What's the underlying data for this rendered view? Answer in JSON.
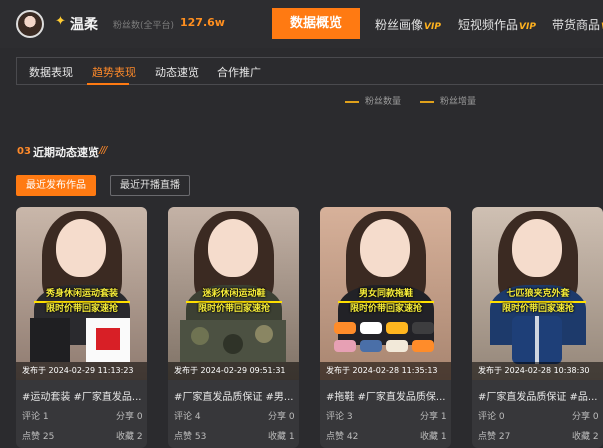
{
  "header": {
    "username": "温柔",
    "fans_label": "粉丝数(全平台)",
    "fans_value": "127.6w",
    "nav": [
      {
        "label": "数据概览",
        "vip": false
      },
      {
        "label": "粉丝画像",
        "vip": true
      },
      {
        "label": "短视频作品",
        "vip": true
      },
      {
        "label": "带货商品",
        "vip": true
      }
    ],
    "vip_text": "VIP"
  },
  "subtabs": [
    "数据表现",
    "趋势表现",
    "动态速览",
    "合作推广"
  ],
  "active_subtab": "趋势表现",
  "legend": [
    "粉丝数量",
    "粉丝增量"
  ],
  "section": {
    "number": "03",
    "title": "近期动态速览",
    "deco": "///"
  },
  "buttons": {
    "latest_works": "最近发布作品",
    "latest_live": "最近开播直播"
  },
  "cards": [
    {
      "caption_top": "秀身休闲运动套装",
      "caption_bottom": "限时价带回家速抢",
      "time": "发布于 2024-02-29 11:13:23",
      "title": "#运动套装 #厂家直发品...",
      "comments_label": "评论",
      "comments": "1",
      "shares_label": "分享",
      "shares": "0",
      "likes_label": "点赞",
      "likes": "25",
      "favorites_label": "收藏",
      "favorites": "2"
    },
    {
      "caption_top": "迷彩休闲运动鞋",
      "caption_bottom": "限时价带回家速抢",
      "time": "发布于 2024-02-29 09:51:31",
      "title": "#厂家直发品质保证 #男...",
      "comments_label": "评论",
      "comments": "4",
      "shares_label": "分享",
      "shares": "0",
      "likes_label": "点赞",
      "likes": "53",
      "favorites_label": "收藏",
      "favorites": "1"
    },
    {
      "caption_top": "男女同款拖鞋",
      "caption_bottom": "限时价带回家速抢",
      "time": "发布于 2024-02-28 11:35:13",
      "title": "#拖鞋 #厂家直发品质保...",
      "comments_label": "评论",
      "comments": "3",
      "shares_label": "分享",
      "shares": "1",
      "likes_label": "点赞",
      "likes": "42",
      "favorites_label": "收藏",
      "favorites": "1"
    },
    {
      "caption_top": "七匹狼夹克外套",
      "caption_bottom": "限时价带回家速抢",
      "time": "发布于 2024-02-28 10:38:30",
      "title": "#厂家直发品质保证 #品...",
      "comments_label": "评论",
      "comments": "0",
      "shares_label": "分享",
      "shares": "0",
      "likes_label": "点赞",
      "likes": "27",
      "favorites_label": "收藏",
      "favorites": "2"
    }
  ],
  "colors": {
    "accent": "#ff7a12",
    "background": "#2b2b2e",
    "card": "#37373a",
    "caption": "#f7ee3a"
  }
}
